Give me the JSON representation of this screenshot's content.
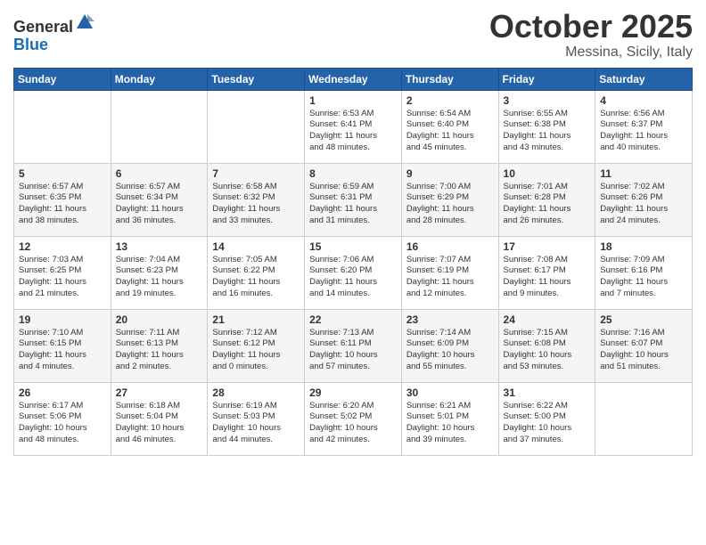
{
  "logo": {
    "general": "General",
    "blue": "Blue"
  },
  "header": {
    "month": "October 2025",
    "location": "Messina, Sicily, Italy"
  },
  "weekdays": [
    "Sunday",
    "Monday",
    "Tuesday",
    "Wednesday",
    "Thursday",
    "Friday",
    "Saturday"
  ],
  "weeks": [
    [
      {
        "day": "",
        "info": ""
      },
      {
        "day": "",
        "info": ""
      },
      {
        "day": "",
        "info": ""
      },
      {
        "day": "1",
        "info": "Sunrise: 6:53 AM\nSunset: 6:41 PM\nDaylight: 11 hours\nand 48 minutes."
      },
      {
        "day": "2",
        "info": "Sunrise: 6:54 AM\nSunset: 6:40 PM\nDaylight: 11 hours\nand 45 minutes."
      },
      {
        "day": "3",
        "info": "Sunrise: 6:55 AM\nSunset: 6:38 PM\nDaylight: 11 hours\nand 43 minutes."
      },
      {
        "day": "4",
        "info": "Sunrise: 6:56 AM\nSunset: 6:37 PM\nDaylight: 11 hours\nand 40 minutes."
      }
    ],
    [
      {
        "day": "5",
        "info": "Sunrise: 6:57 AM\nSunset: 6:35 PM\nDaylight: 11 hours\nand 38 minutes."
      },
      {
        "day": "6",
        "info": "Sunrise: 6:57 AM\nSunset: 6:34 PM\nDaylight: 11 hours\nand 36 minutes."
      },
      {
        "day": "7",
        "info": "Sunrise: 6:58 AM\nSunset: 6:32 PM\nDaylight: 11 hours\nand 33 minutes."
      },
      {
        "day": "8",
        "info": "Sunrise: 6:59 AM\nSunset: 6:31 PM\nDaylight: 11 hours\nand 31 minutes."
      },
      {
        "day": "9",
        "info": "Sunrise: 7:00 AM\nSunset: 6:29 PM\nDaylight: 11 hours\nand 28 minutes."
      },
      {
        "day": "10",
        "info": "Sunrise: 7:01 AM\nSunset: 6:28 PM\nDaylight: 11 hours\nand 26 minutes."
      },
      {
        "day": "11",
        "info": "Sunrise: 7:02 AM\nSunset: 6:26 PM\nDaylight: 11 hours\nand 24 minutes."
      }
    ],
    [
      {
        "day": "12",
        "info": "Sunrise: 7:03 AM\nSunset: 6:25 PM\nDaylight: 11 hours\nand 21 minutes."
      },
      {
        "day": "13",
        "info": "Sunrise: 7:04 AM\nSunset: 6:23 PM\nDaylight: 11 hours\nand 19 minutes."
      },
      {
        "day": "14",
        "info": "Sunrise: 7:05 AM\nSunset: 6:22 PM\nDaylight: 11 hours\nand 16 minutes."
      },
      {
        "day": "15",
        "info": "Sunrise: 7:06 AM\nSunset: 6:20 PM\nDaylight: 11 hours\nand 14 minutes."
      },
      {
        "day": "16",
        "info": "Sunrise: 7:07 AM\nSunset: 6:19 PM\nDaylight: 11 hours\nand 12 minutes."
      },
      {
        "day": "17",
        "info": "Sunrise: 7:08 AM\nSunset: 6:17 PM\nDaylight: 11 hours\nand 9 minutes."
      },
      {
        "day": "18",
        "info": "Sunrise: 7:09 AM\nSunset: 6:16 PM\nDaylight: 11 hours\nand 7 minutes."
      }
    ],
    [
      {
        "day": "19",
        "info": "Sunrise: 7:10 AM\nSunset: 6:15 PM\nDaylight: 11 hours\nand 4 minutes."
      },
      {
        "day": "20",
        "info": "Sunrise: 7:11 AM\nSunset: 6:13 PM\nDaylight: 11 hours\nand 2 minutes."
      },
      {
        "day": "21",
        "info": "Sunrise: 7:12 AM\nSunset: 6:12 PM\nDaylight: 11 hours\nand 0 minutes."
      },
      {
        "day": "22",
        "info": "Sunrise: 7:13 AM\nSunset: 6:11 PM\nDaylight: 10 hours\nand 57 minutes."
      },
      {
        "day": "23",
        "info": "Sunrise: 7:14 AM\nSunset: 6:09 PM\nDaylight: 10 hours\nand 55 minutes."
      },
      {
        "day": "24",
        "info": "Sunrise: 7:15 AM\nSunset: 6:08 PM\nDaylight: 10 hours\nand 53 minutes."
      },
      {
        "day": "25",
        "info": "Sunrise: 7:16 AM\nSunset: 6:07 PM\nDaylight: 10 hours\nand 51 minutes."
      }
    ],
    [
      {
        "day": "26",
        "info": "Sunrise: 6:17 AM\nSunset: 5:06 PM\nDaylight: 10 hours\nand 48 minutes."
      },
      {
        "day": "27",
        "info": "Sunrise: 6:18 AM\nSunset: 5:04 PM\nDaylight: 10 hours\nand 46 minutes."
      },
      {
        "day": "28",
        "info": "Sunrise: 6:19 AM\nSunset: 5:03 PM\nDaylight: 10 hours\nand 44 minutes."
      },
      {
        "day": "29",
        "info": "Sunrise: 6:20 AM\nSunset: 5:02 PM\nDaylight: 10 hours\nand 42 minutes."
      },
      {
        "day": "30",
        "info": "Sunrise: 6:21 AM\nSunset: 5:01 PM\nDaylight: 10 hours\nand 39 minutes."
      },
      {
        "day": "31",
        "info": "Sunrise: 6:22 AM\nSunset: 5:00 PM\nDaylight: 10 hours\nand 37 minutes."
      },
      {
        "day": "",
        "info": ""
      }
    ]
  ]
}
